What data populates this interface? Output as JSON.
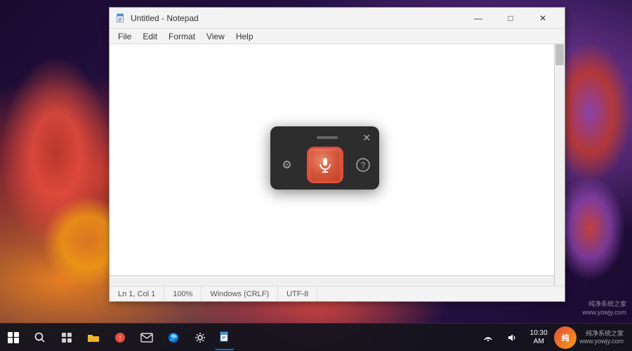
{
  "desktop": {
    "background": "colorful blobs"
  },
  "notepad": {
    "title": "Untitled - Notepad",
    "menu": {
      "items": [
        "File",
        "Edit",
        "Format",
        "View",
        "Help"
      ]
    },
    "content": "",
    "statusbar": {
      "position": "Ln 1, Col 1",
      "zoom": "100%",
      "lineending": "Windows (CRLF)",
      "encoding": "UTF-8"
    },
    "titlebar": {
      "minimize": "—",
      "maximize": "□",
      "close": "✕"
    }
  },
  "voice_widget": {
    "close_label": "✕",
    "settings_icon": "⚙",
    "help_icon": "?",
    "mic_icon": "🎤"
  },
  "taskbar": {
    "items": [
      {
        "name": "start",
        "icon": "win"
      },
      {
        "name": "search",
        "icon": "🔍"
      },
      {
        "name": "taskview",
        "icon": "⊞"
      },
      {
        "name": "explorer",
        "icon": "📁"
      },
      {
        "name": "store",
        "icon": "🛍"
      },
      {
        "name": "mail",
        "icon": "✉"
      },
      {
        "name": "edge",
        "icon": "e"
      },
      {
        "name": "settings",
        "icon": "⚙"
      },
      {
        "name": "notepad",
        "icon": "📄"
      }
    ],
    "right": {
      "brand_line1": "纯净系统之家",
      "brand_line2": "www.yowjy.com"
    }
  }
}
